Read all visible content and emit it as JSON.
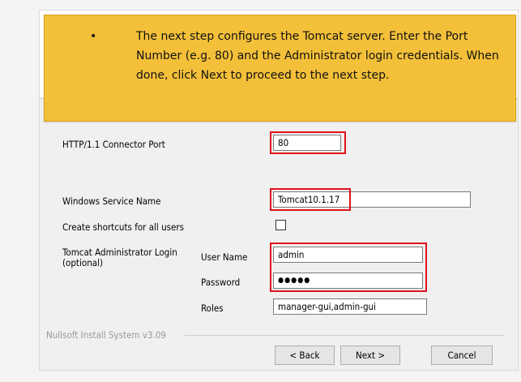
{
  "callout": {
    "text": "The next step configures the Tomcat server. Enter the Port Number (e.g. 80) and the Administrator login credentials. When done, click Next to proceed to the next step."
  },
  "form": {
    "port_label": "HTTP/1.1 Connector Port",
    "port_value": "80",
    "service_label": "Windows Service Name",
    "service_value": "Tomcat10.1.17",
    "shortcuts_label": "Create shortcuts for all users",
    "admin_label": "Tomcat Administrator Login\n(optional)",
    "username_label": "User Name",
    "username_value": "admin",
    "password_label": "Password",
    "password_value": "●●●●●",
    "roles_label": "Roles",
    "roles_value": "manager-gui,admin-gui"
  },
  "footer": {
    "branding": "Nullsoft Install System v3.09",
    "back_label": "< Back",
    "next_label": "Next >",
    "cancel_label": "Cancel"
  },
  "colors": {
    "callout_bg": "#f4c039",
    "highlight": "#e0121b"
  }
}
